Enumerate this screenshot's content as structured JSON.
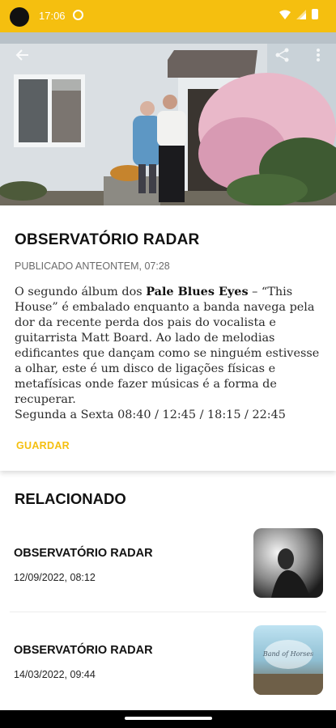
{
  "status_bar": {
    "time": "17:06",
    "accent_color": "#f5bf0f",
    "icons": [
      "sync-icon",
      "wifi-icon",
      "signal-icon",
      "battery-icon"
    ]
  },
  "hero": {
    "image": "photo of an older couple standing outside a white house with a flowering tree",
    "buttons": [
      "back-arrow-icon",
      "share-icon",
      "more-vert-icon"
    ]
  },
  "article": {
    "title": "OBSERVATÓRIO RADAR",
    "published": "PUBLICADO ANTEONTEM, 07:28",
    "body_intro": "O segundo álbum dos ",
    "body_band": "Pale Blues Eyes",
    "body_mid": " – “This House” é embalado enquanto a banda navega pela dor da recente perda dos pais do vocalista e guitarrista ",
    "body_artist": "Matt Board",
    "body_end": ". Ao lado de melodias edificantes que dançam como se ninguém estivesse a olhar, este é um disco de ligações físicas e metafísicas onde fazer músicas é a forma de recuperar.",
    "schedule": "Segunda a Sexta 08:40 / 12:45 / 18:15 / 22:45",
    "save_label": "GUARDAR"
  },
  "related": {
    "title": "RELACIONADO",
    "items": [
      {
        "title": "OBSERVATÓRIO RADAR",
        "date": "12/09/2022, 08:12"
      },
      {
        "title": "OBSERVATÓRIO RADAR",
        "date": "14/03/2022, 09:44"
      }
    ]
  }
}
